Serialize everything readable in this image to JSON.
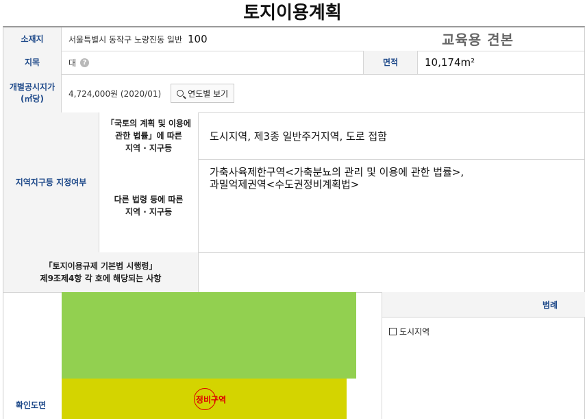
{
  "title": "토지이용계획",
  "watermark": "교육용 견본",
  "rows": {
    "address": {
      "label": "소재지",
      "value": "서울특별시 동작구 노량진동 일반",
      "number": "100"
    },
    "jimok": {
      "label": "지목",
      "value": "대",
      "help_icon": "?",
      "area_label": "면적",
      "area_value": "10,174m²"
    },
    "price": {
      "label_line1": "개별공시지가",
      "label_line2": "(㎡당)",
      "value": "4,724,000원 (2020/01)",
      "button": "연도별 보기"
    },
    "zoning": {
      "label": "지역지구등 지정여부",
      "sub1_line1": "「국토의 계획 및 이용에",
      "sub1_line2": "관한 법률」에 따른",
      "sub1_line3": "지역 · 지구등",
      "sub1_value": "도시지역, 제3종 일반주거지역, 도로 접함",
      "sub2_line1": "다른 법령 등에 따른",
      "sub2_line2": "지역 · 지구등",
      "sub2_value_line1": "가축사육제한구역<가축분뇨의 관리 및 이용에 관한 법률>,",
      "sub2_value_line2": "과밀억제권역<수도권정비계획법>"
    },
    "regulation": {
      "label_line1": "「토지이용규제 기본법 시행령」",
      "label_line2": "제9조제4항 각 호에 해당되는 사항"
    },
    "map": {
      "label": "확인도면",
      "mark_text": "정비구역",
      "legend_title": "범례",
      "legend_item": "도시지역"
    }
  },
  "colors": {
    "header_text": "#1f4a8a",
    "header_bg": "#f4f4f4",
    "map_green": "#92d050",
    "map_yellow": "#d4d400",
    "mark_red": "#dd0000"
  }
}
